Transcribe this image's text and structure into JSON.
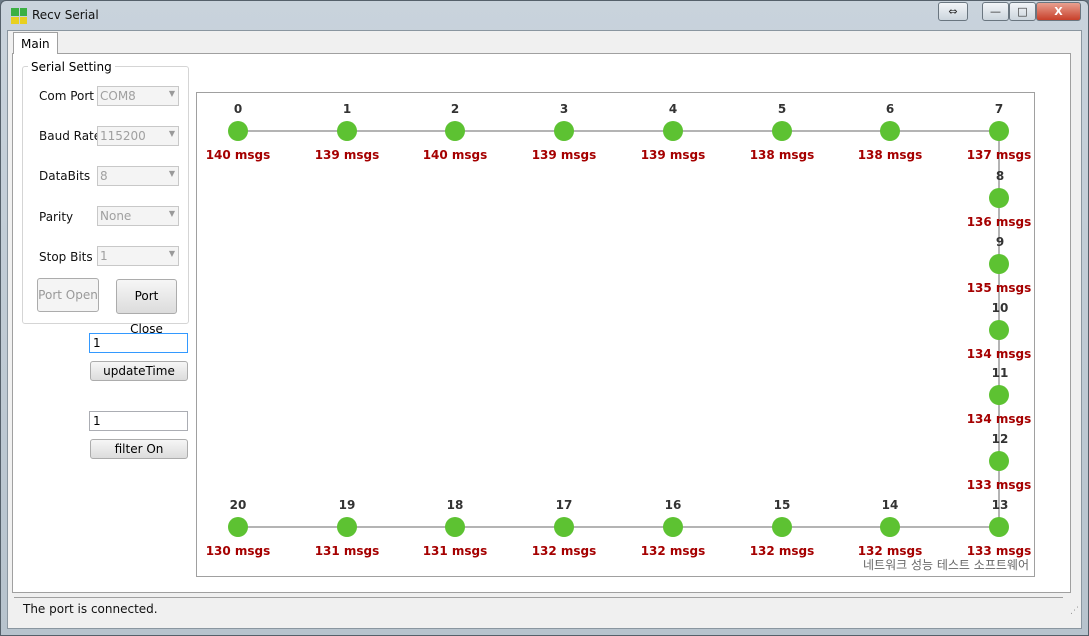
{
  "window": {
    "title": "Recv Serial",
    "buttons": {
      "restore_alt": "⇔",
      "minimize": "—",
      "maximize": "□",
      "close": "X"
    }
  },
  "tabs": [
    {
      "label": "Main",
      "active": true
    }
  ],
  "serial_setting": {
    "title": "Serial Setting",
    "fields": [
      {
        "label": "Com Port",
        "value": "COM8"
      },
      {
        "label": "Baud Rate",
        "value": "115200"
      },
      {
        "label": "DataBits",
        "value": "8"
      },
      {
        "label": "Parity",
        "value": "None"
      },
      {
        "label": "Stop Bits",
        "value": "1"
      }
    ],
    "port_open": "Port Open",
    "port_close": "Port Close"
  },
  "update_time": {
    "value": "1",
    "button": "updateTime"
  },
  "filter": {
    "value": "1",
    "button": "filter On"
  },
  "network": {
    "node_color": "#5dc232",
    "count_color": "#a50000",
    "line_color": "#b4b4b4",
    "nodes": [
      {
        "id": "0",
        "count": "140 msgs"
      },
      {
        "id": "1",
        "count": "139 msgs"
      },
      {
        "id": "2",
        "count": "140 msgs"
      },
      {
        "id": "3",
        "count": "139 msgs"
      },
      {
        "id": "4",
        "count": "139 msgs"
      },
      {
        "id": "5",
        "count": "138 msgs"
      },
      {
        "id": "6",
        "count": "138 msgs"
      },
      {
        "id": "7",
        "count": "137 msgs"
      },
      {
        "id": "8",
        "count": "136 msgs"
      },
      {
        "id": "9",
        "count": "135 msgs"
      },
      {
        "id": "10",
        "count": "134 msgs"
      },
      {
        "id": "11",
        "count": "134 msgs"
      },
      {
        "id": "12",
        "count": "133 msgs"
      },
      {
        "id": "13",
        "count": "133 msgs"
      },
      {
        "id": "14",
        "count": "132 msgs"
      },
      {
        "id": "15",
        "count": "132 msgs"
      },
      {
        "id": "16",
        "count": "132 msgs"
      },
      {
        "id": "17",
        "count": "132 msgs"
      },
      {
        "id": "18",
        "count": "131 msgs"
      },
      {
        "id": "19",
        "count": "131 msgs"
      },
      {
        "id": "20",
        "count": "130 msgs"
      }
    ],
    "watermark": "네트워크 성능 테스트 소프트웨어"
  },
  "status": {
    "text": "The port is connected."
  }
}
